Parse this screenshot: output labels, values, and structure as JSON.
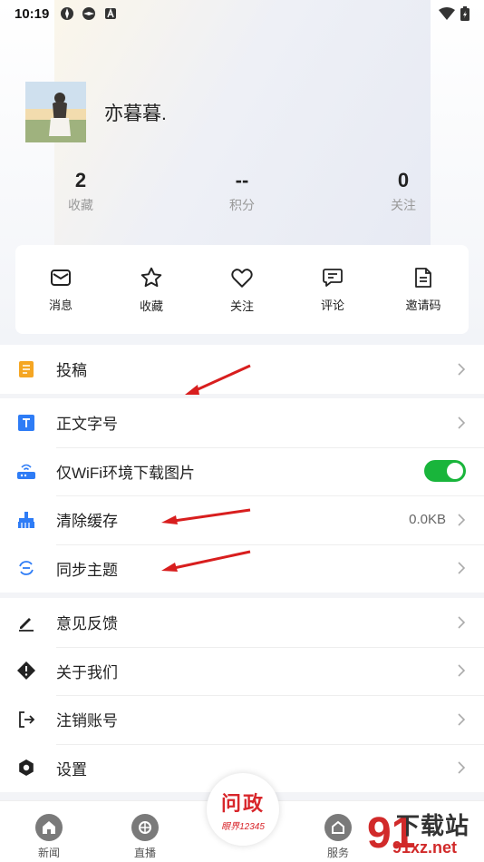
{
  "status_bar": {
    "time": "10:19"
  },
  "profile": {
    "username": "亦暮暮."
  },
  "stats": [
    {
      "value": "2",
      "label": "收藏"
    },
    {
      "value": "--",
      "label": "积分"
    },
    {
      "value": "0",
      "label": "关注"
    }
  ],
  "quick_actions": [
    {
      "label": "消息",
      "icon": "mail-icon"
    },
    {
      "label": "收藏",
      "icon": "star-icon"
    },
    {
      "label": "关注",
      "icon": "heart-icon"
    },
    {
      "label": "评论",
      "icon": "comment-icon"
    },
    {
      "label": "邀请码",
      "icon": "document-icon"
    }
  ],
  "menu_group1": [
    {
      "label": "投稿",
      "icon": "submit-icon",
      "color": "#f5a623"
    }
  ],
  "menu_group2": [
    {
      "label": "正文字号",
      "icon": "font-size-icon",
      "color": "#2e7cf6"
    },
    {
      "label": "仅WiFi环境下载图片",
      "icon": "wifi-router-icon",
      "color": "#2e7cf6",
      "toggle": true
    },
    {
      "label": "清除缓存",
      "icon": "broom-icon",
      "color": "#2e7cf6",
      "value": "0.0KB"
    },
    {
      "label": "同步主题",
      "icon": "sync-icon",
      "color": "#2e7cf6"
    }
  ],
  "menu_group3": [
    {
      "label": "意见反馈",
      "icon": "pencil-icon"
    },
    {
      "label": "关于我们",
      "icon": "info-diamond-icon"
    },
    {
      "label": "注销账号",
      "icon": "logout-icon"
    },
    {
      "label": "设置",
      "icon": "settings-icon"
    }
  ],
  "tabbar": {
    "tabs": [
      {
        "label": "新闻",
        "icon": "home-icon"
      },
      {
        "label": "直播",
        "icon": "live-icon"
      },
      {
        "label": "服务",
        "icon": "service-icon"
      }
    ],
    "center": {
      "title": "问政",
      "subtitle": "眼界12345"
    }
  },
  "watermark": {
    "title": "下载站",
    "subtitle": "91xz.net",
    "logo": "91"
  },
  "colors": {
    "accent": "#2e7cf6",
    "toggle_on": "#19b53b",
    "annotation_arrow": "#d81e1e"
  }
}
